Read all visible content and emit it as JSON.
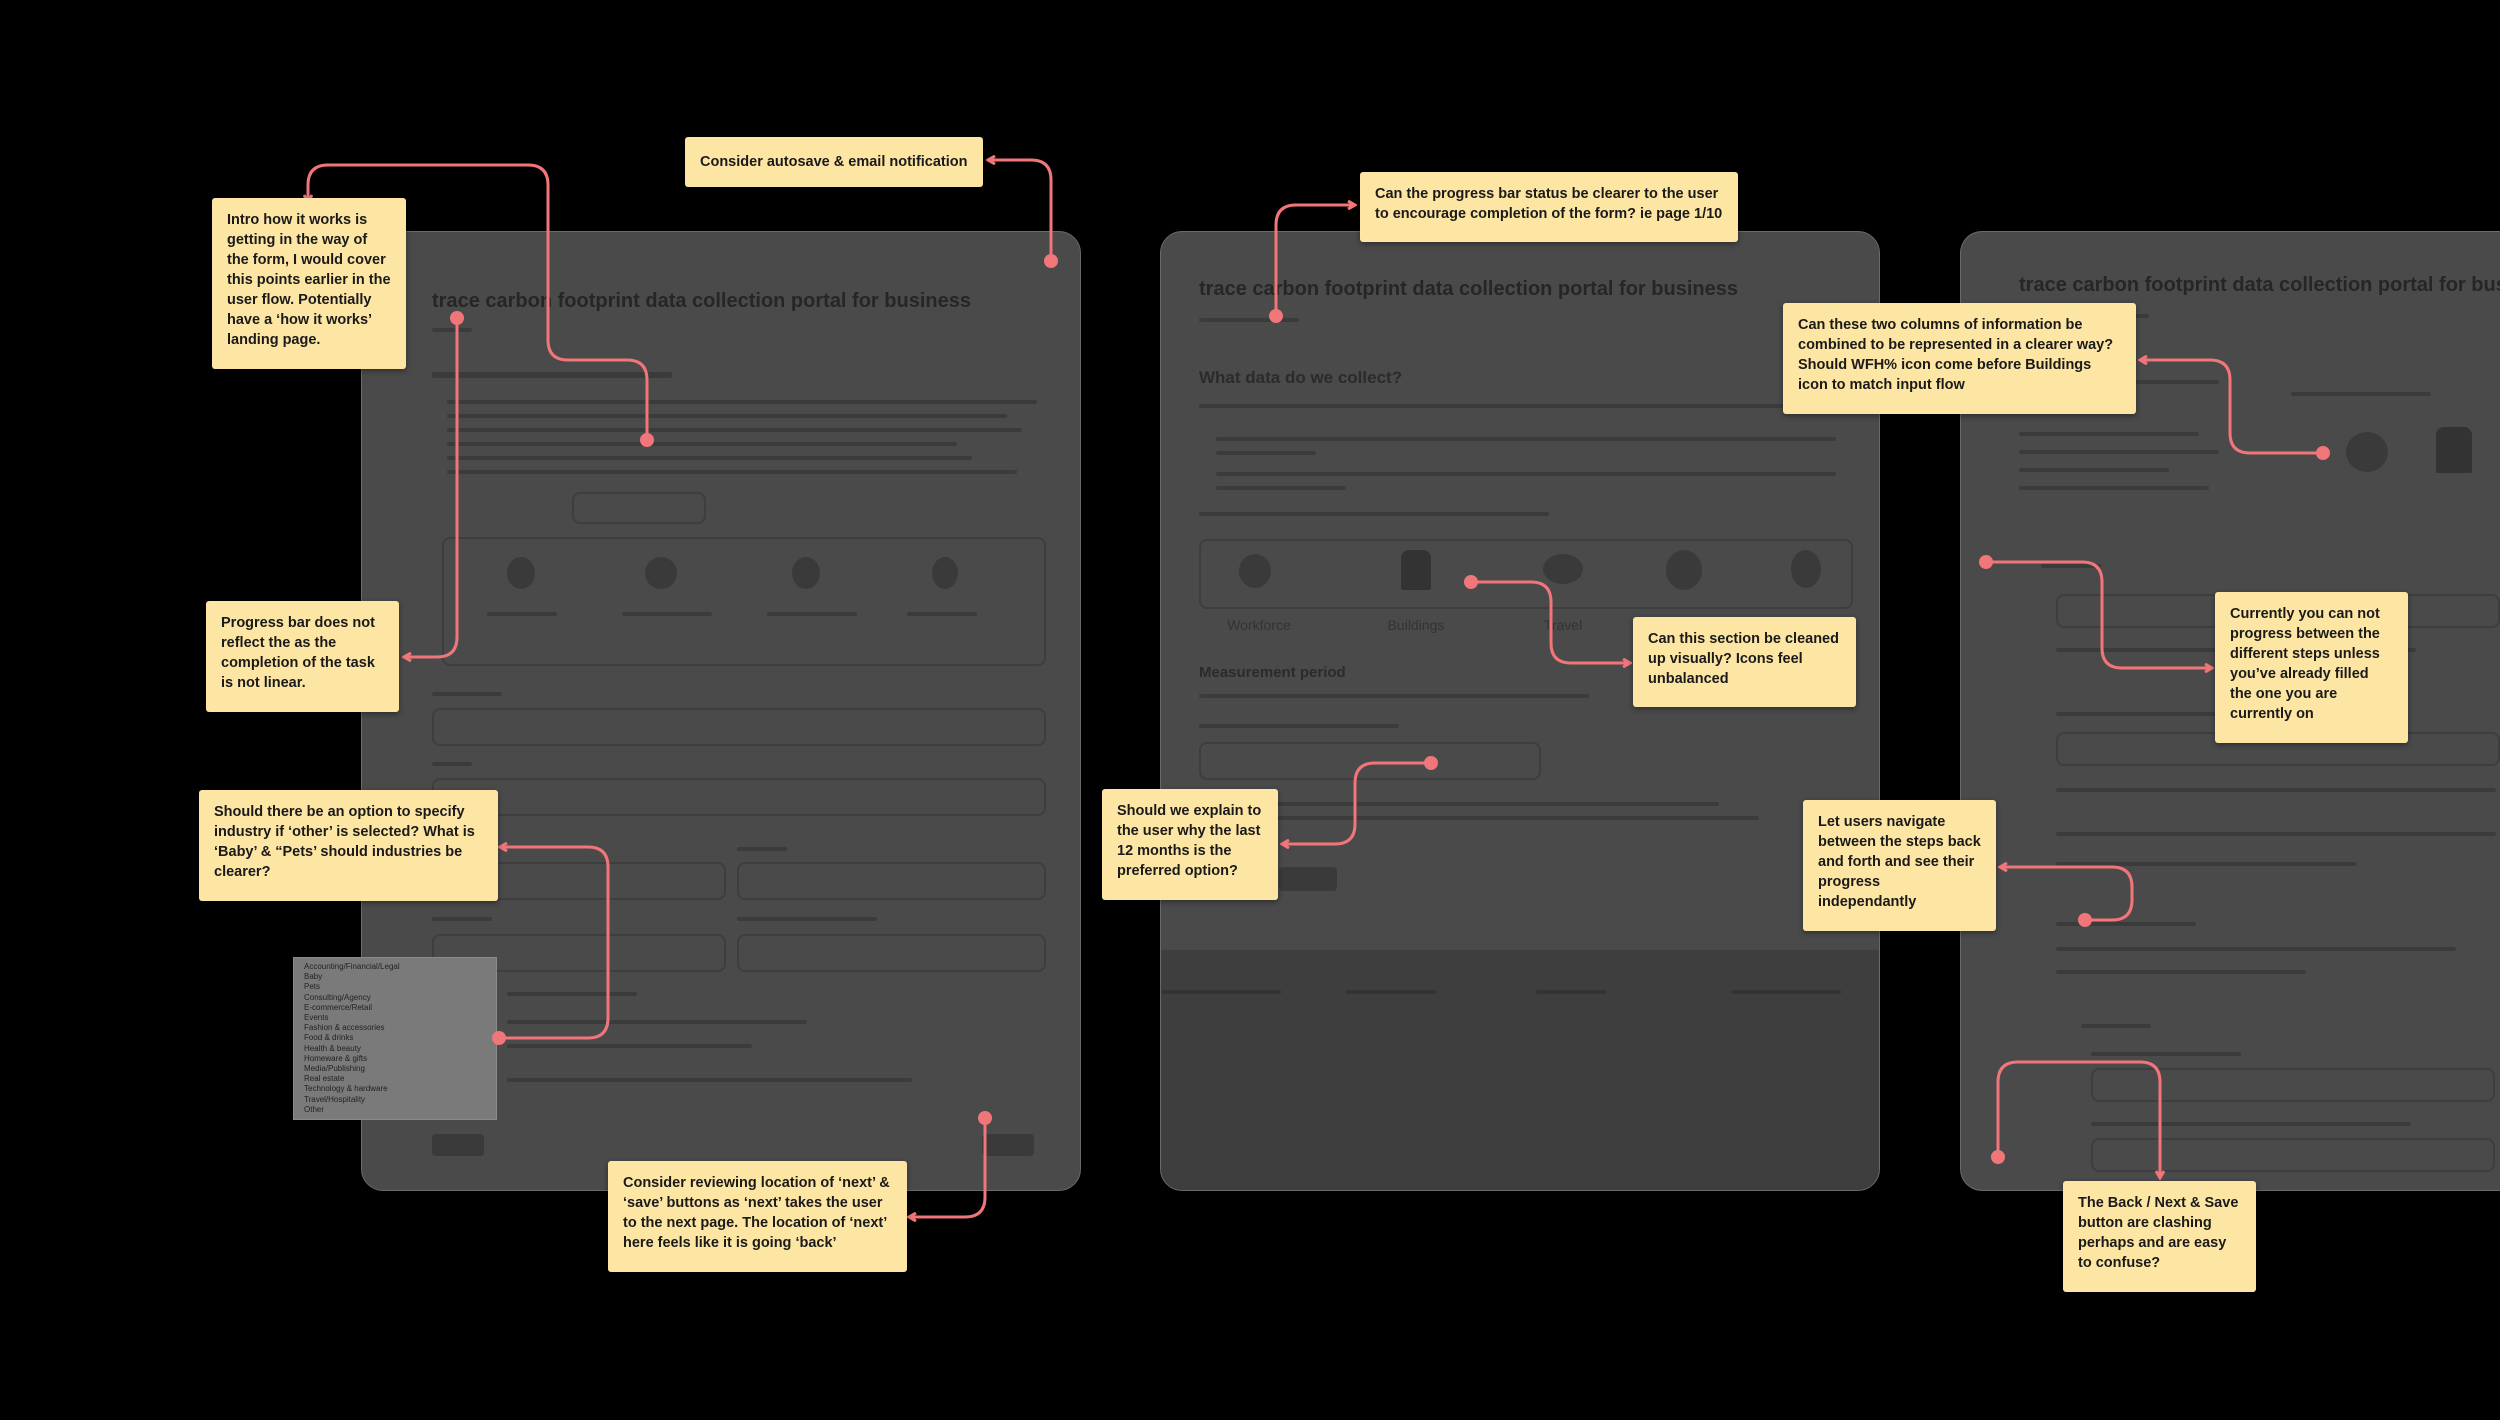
{
  "screens": [
    {
      "title": "trace carbon footprint data collection portal for business"
    },
    {
      "title": "trace carbon footprint data collection portal for business",
      "heading": "What data do we collect?",
      "icon_labels": [
        "Workforce",
        "Buildings",
        "Travel"
      ],
      "section": "Measurement period"
    },
    {
      "title": "trace carbon footprint data collection portal for bus"
    }
  ],
  "dropdown_options": [
    "Accounting/Financial/Legal",
    "Baby",
    "Pets",
    "Consulting/Agency",
    "E-commerce/Retail",
    "Events",
    "Fashion & accessories",
    "Food & drinks",
    "Health & beauty",
    "Homeware & gifts",
    "Media/Publishing",
    "Real estate",
    "Technology & hardware",
    "Travel/Hospitality",
    "Other"
  ],
  "notes": [
    {
      "id": "autosave",
      "text": "Consider autosave & email notification"
    },
    {
      "id": "intro",
      "text": "Intro how it works is getting in the way of the form, I would cover this points earlier in the user flow. Potentially have a ‘how it works’ landing page."
    },
    {
      "id": "progress-linear",
      "text": "Progress bar does not reflect the as the completion of the task is not linear."
    },
    {
      "id": "industry",
      "text": "Should there be an option to specify industry if ‘other’ is selected? What is ‘Baby’ & “Pets’ should industries be clearer?"
    },
    {
      "id": "next-save",
      "text": "Consider reviewing location of ‘next’ & ‘save’ buttons as ‘next’ takes the user to the next page. The location of ‘next’ here feels like it is going ‘back’"
    },
    {
      "id": "progress-clearer",
      "text": "Can the progress bar status be clearer to the user to encourage completion of the form? ie page 1/10"
    },
    {
      "id": "icons",
      "text": "Can this section be cleaned up visually? Icons feel unbalanced"
    },
    {
      "id": "twelve-months",
      "text": "Should we explain to the user why the last 12 months is the preferred option?"
    },
    {
      "id": "columns",
      "text": "Can these two columns of information be combined to be represented in a clearer way? Should WFH% icon come before Buildings icon to match input flow"
    },
    {
      "id": "cannot-progress",
      "text": "Currently you can not progress between the different steps unless you’ve already filled the one you are currently on"
    },
    {
      "id": "navigate",
      "text": "Let users navigate between the steps back and forth and see their progress independantly"
    },
    {
      "id": "back-next-save",
      "text": "The Back / Next & Save button are clashing perhaps and are easy to confuse?"
    }
  ],
  "colors": {
    "note": "#fde5a3",
    "annotation": "#f0767a",
    "panel": "#4a4a4a",
    "background": "#000000"
  }
}
